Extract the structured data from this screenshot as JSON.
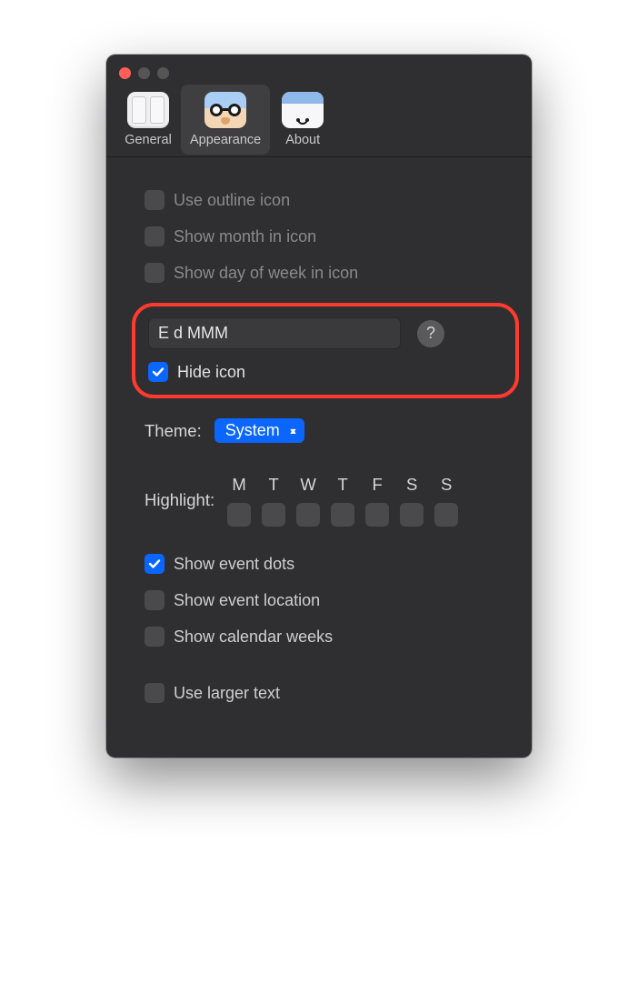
{
  "toolbar": {
    "tabs": [
      {
        "label": "General"
      },
      {
        "label": "Appearance"
      },
      {
        "label": "About"
      }
    ]
  },
  "icon_section": {
    "use_outline_icon": {
      "label": "Use outline icon",
      "checked": false
    },
    "show_month_in_icon": {
      "label": "Show month in icon",
      "checked": false
    },
    "show_day_of_week_in_icon": {
      "label": "Show day of week in icon",
      "checked": false
    }
  },
  "format": {
    "value": "E d MMM",
    "help_label": "?",
    "hide_icon": {
      "label": "Hide icon",
      "checked": true
    }
  },
  "theme": {
    "label": "Theme:",
    "selected": "System"
  },
  "highlight": {
    "label": "Highlight:",
    "days": [
      "M",
      "T",
      "W",
      "T",
      "F",
      "S",
      "S"
    ]
  },
  "options": {
    "show_event_dots": {
      "label": "Show event dots",
      "checked": true
    },
    "show_event_location": {
      "label": "Show event location",
      "checked": false
    },
    "show_calendar_weeks": {
      "label": "Show calendar weeks",
      "checked": false
    },
    "use_larger_text": {
      "label": "Use larger text",
      "checked": false
    }
  }
}
